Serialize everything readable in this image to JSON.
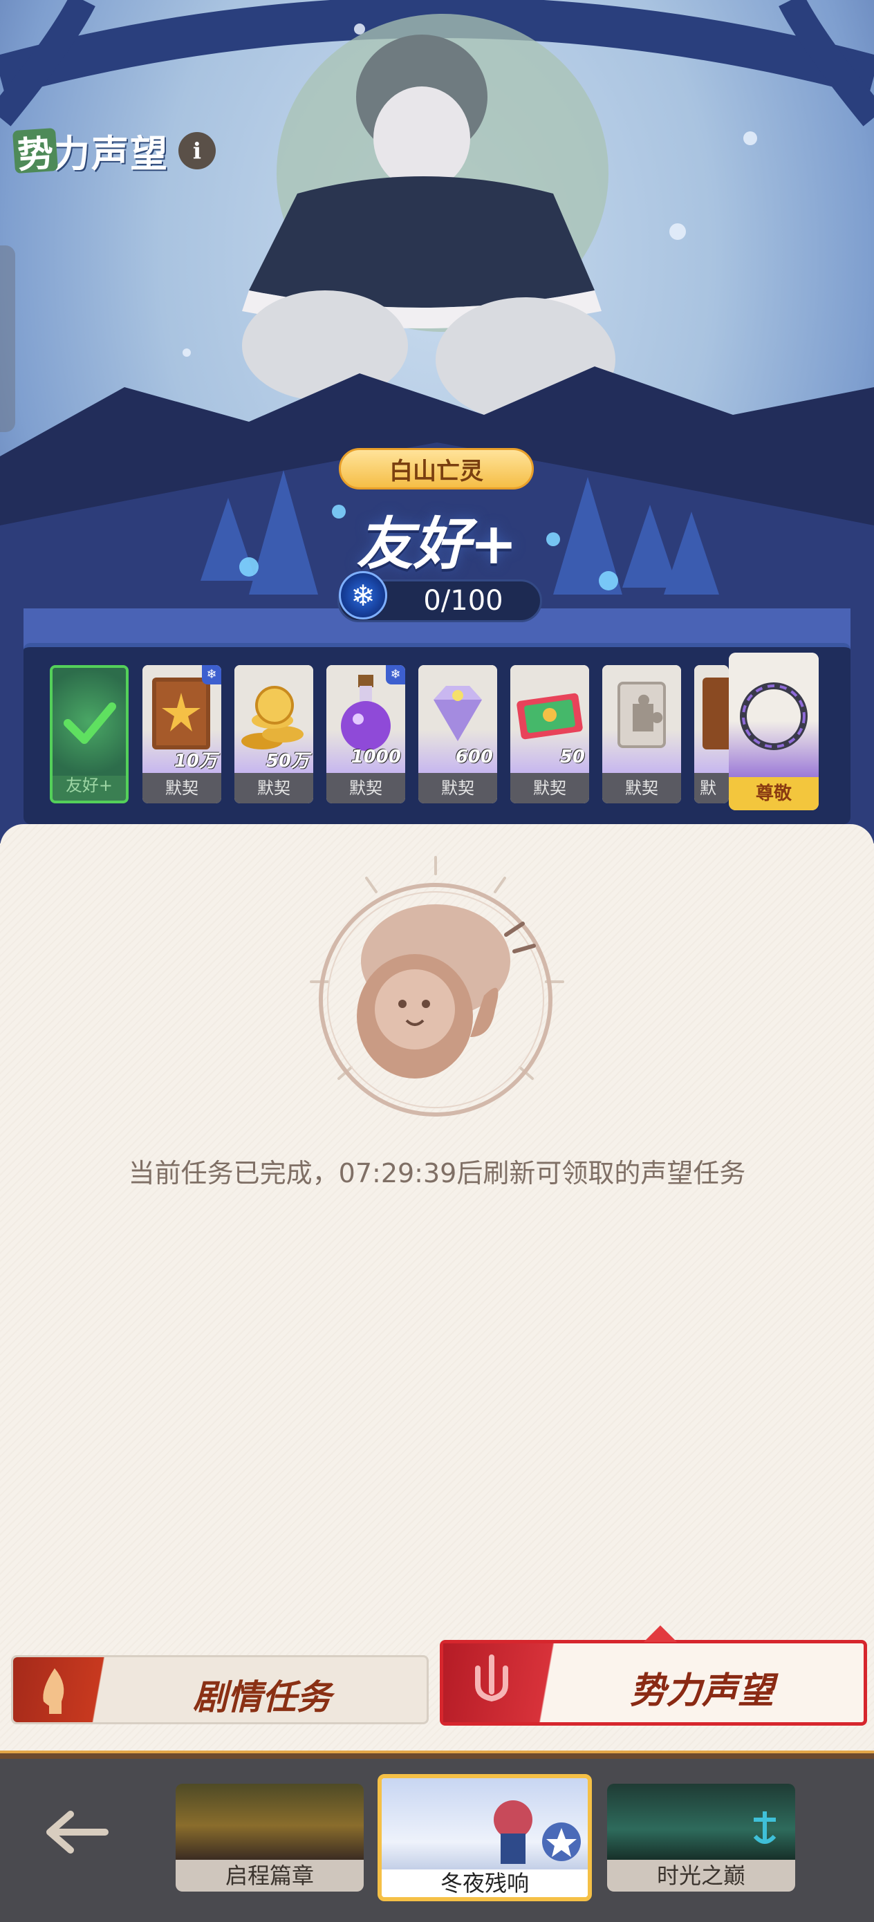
{
  "header": {
    "title_badge": "势",
    "title": "力声望",
    "info_label": "i"
  },
  "hero": {
    "faction_name": "白山亡灵",
    "reputation_level": "友好+",
    "progress_text": "0/100",
    "progress_fraction": 0.0
  },
  "rewards": [
    {
      "qty": "",
      "label": "友好+",
      "state": "claimed",
      "icon": "check-icon"
    },
    {
      "qty": "10万",
      "label": "默契",
      "icon": "book-icon",
      "snow_badge": true
    },
    {
      "qty": "50万",
      "label": "默契",
      "icon": "coins-icon"
    },
    {
      "qty": "1000",
      "label": "默契",
      "icon": "potion-icon",
      "snow_badge": true
    },
    {
      "qty": "600",
      "label": "默契",
      "icon": "diamond-icon"
    },
    {
      "qty": "50",
      "label": "默契",
      "icon": "ticket-icon"
    },
    {
      "qty": "",
      "label": "默契",
      "icon": "puzzle-icon"
    },
    {
      "qty": "",
      "label": "默",
      "icon": "book-icon"
    }
  ],
  "honor_reward": {
    "label": "尊敬",
    "icon": "ring-icon"
  },
  "status": {
    "message": "当前任务已完成，07:29:39后刷新可领取的声望任务"
  },
  "tabs": {
    "story": "剧情任务",
    "reputation": "势力声望"
  },
  "chapters": [
    {
      "label": "启程篇章"
    },
    {
      "label": "冬夜残响",
      "selected": true
    },
    {
      "label": "时光之巅"
    }
  ],
  "colors": {
    "accent_red": "#d6262d",
    "gold": "#f5c046",
    "claimed_green": "#54d05a",
    "text_muted": "#7f6f65"
  }
}
